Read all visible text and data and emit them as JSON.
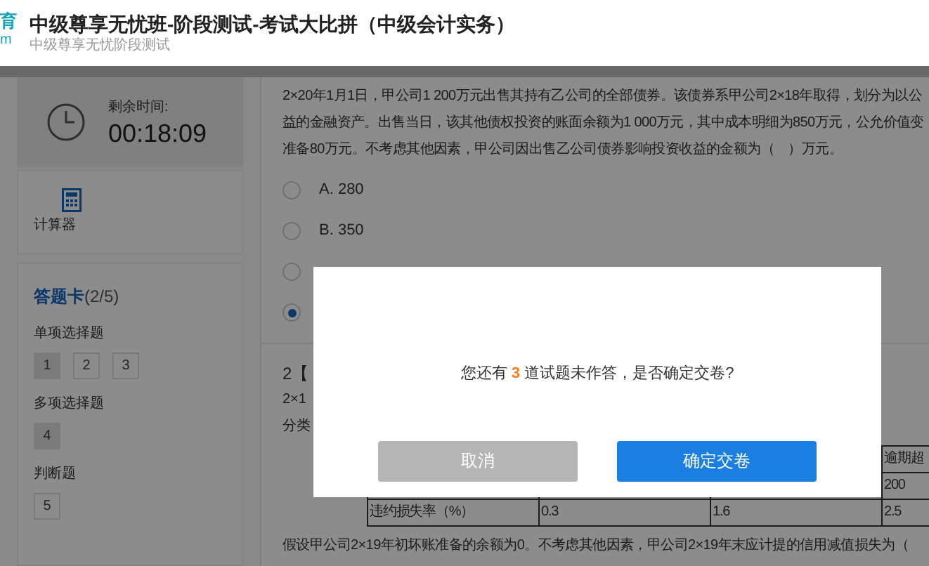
{
  "header": {
    "logo_top": "育",
    "logo_bottom": "m",
    "title": "中级尊享无忧班-阶段测试-考试大比拼（中级会计实务）",
    "subtitle": "中级尊享无忧阶段测试"
  },
  "timer": {
    "label": "剩余时间:",
    "value": "00:18:09"
  },
  "calculator": {
    "label": "计算器"
  },
  "answer_card": {
    "title": "答题卡",
    "progress": "(2/5)",
    "sections": [
      {
        "label": "单项选择题",
        "items": [
          {
            "number": "1",
            "answered": true
          },
          {
            "number": "2",
            "answered": false
          },
          {
            "number": "3",
            "answered": false
          }
        ]
      },
      {
        "label": "多项选择题",
        "items": [
          {
            "number": "4",
            "answered": true
          }
        ]
      },
      {
        "label": "判断题",
        "items": [
          {
            "number": "5",
            "answered": false
          }
        ]
      }
    ]
  },
  "question_1": {
    "lines": [
      "2×20年1月1日，甲公司1 200万元出售其持有乙公司的全部债券。该债券系甲公司2×18年取得，划分为以公",
      "益的金融资产。出售当日，该其他债权投资的账面余额为1 000万元，其中成本明细为850万元，公允价值变",
      "准备80万元。不考虑其他因素，甲公司因出售乙公司债券影响投资收益的金额为（　）万元。"
    ],
    "options": [
      {
        "label": "A. 280",
        "selected": false
      },
      {
        "label": "B. 350",
        "selected": false
      },
      {
        "selected": false
      },
      {
        "selected": true
      }
    ]
  },
  "question_2": {
    "number": "2【",
    "lines": [
      "2×1",
      "分类"
    ],
    "table": {
      "rows": [
        {
          "column_4": "逾期超"
        },
        {
          "column_4": "200"
        },
        {
          "column_1": "违约损失率（%）",
          "column_2": "0.3",
          "column_3": "1.6",
          "column_4": "2.5"
        }
      ]
    },
    "after_text": "假设甲公司2×19年初坏账准备的余额为0。不考虑其他因素，甲公司2×19年末应计提的信用减值损失为（"
  },
  "dialog": {
    "message_before": "您还有",
    "count": "3",
    "message_after": "道试题未作答，是否确定交卷?",
    "buttons": [
      {
        "label": "取消",
        "kind": "secondary"
      },
      {
        "label": "确定交卷",
        "kind": "primary"
      }
    ]
  }
}
